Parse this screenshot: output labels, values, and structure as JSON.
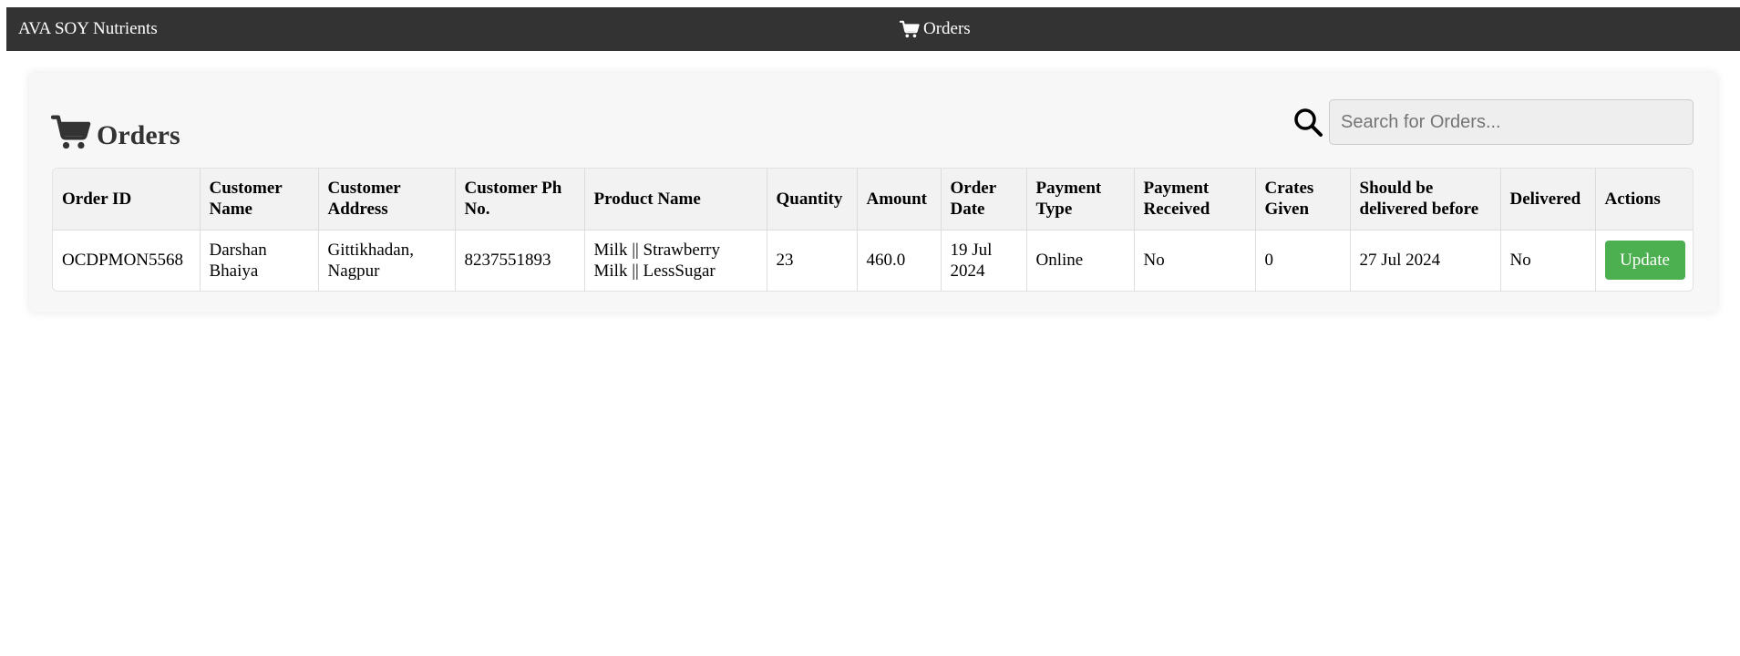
{
  "navbar": {
    "brand": "AVA SOY Nutrients",
    "nav_item": {
      "icon": "cart-icon",
      "label": "Orders"
    },
    "background": "#333333"
  },
  "orders_panel": {
    "title": {
      "icon": "cart-icon",
      "label": "Orders"
    },
    "search": {
      "icon": "search-icon",
      "placeholder": "Search for Orders...",
      "value": ""
    },
    "table": {
      "headers": [
        "Order ID",
        "Customer Name",
        "Customer Address",
        "Customer Ph No.",
        "Product Name",
        "Quantity",
        "Amount",
        "Order Date",
        "Payment Type",
        "Payment Received",
        "Crates Given",
        "Should be delivered before",
        "Delivered",
        "Actions"
      ],
      "rows": [
        {
          "order_id": "OCDPMON5568",
          "customer_name": "Darshan Bhaiya",
          "customer_address": "Gittikhadan, Nagpur",
          "customer_phone": "8237551893",
          "product_name_line1": "Milk || Strawberry",
          "product_name_line2": "Milk || LessSugar",
          "quantity": "23",
          "amount": "460.0",
          "order_date": "19 Jul 2024",
          "payment_type": "Online",
          "payment_received": "No",
          "crates_given": "0",
          "deliver_before": "27 Jul 2024",
          "delivered": "No",
          "action_label": "Update"
        }
      ]
    }
  },
  "colors": {
    "accent_green": "#4caf50",
    "navbar": "#333333",
    "card": "#f7f7f7",
    "header_row": "#f2f2f2"
  }
}
